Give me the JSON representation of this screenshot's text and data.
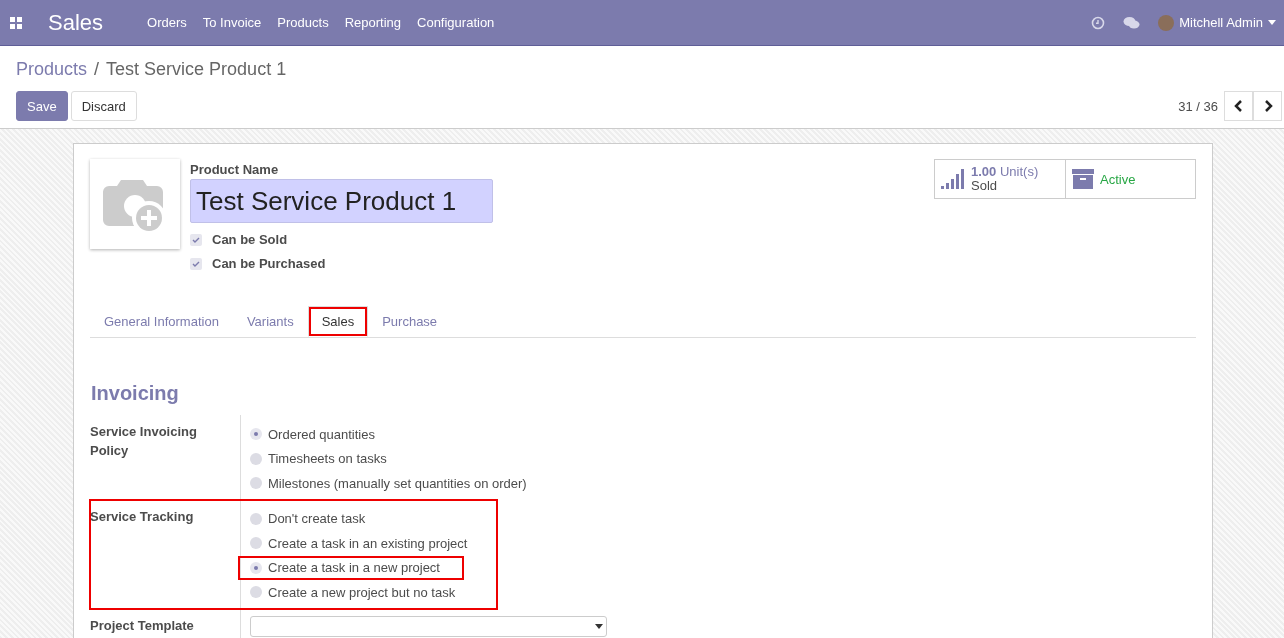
{
  "navbar": {
    "app_title": "Sales",
    "menu": [
      "Orders",
      "To Invoice",
      "Products",
      "Reporting",
      "Configuration"
    ],
    "user": "Mitchell Admin"
  },
  "breadcrumb": {
    "parent": "Products",
    "separator": "/",
    "current": "Test Service Product 1"
  },
  "buttons": {
    "save": "Save",
    "discard": "Discard"
  },
  "pager": "31 / 36",
  "product": {
    "name_label": "Product Name",
    "name": "Test Service Product 1",
    "checkboxes": [
      {
        "label": "Can be Sold",
        "checked": true
      },
      {
        "label": "Can be Purchased",
        "checked": true
      }
    ]
  },
  "stat_buttons": [
    {
      "kind": "sold",
      "value": "1.00",
      "unit": "Unit(s)",
      "label": "Sold"
    },
    {
      "kind": "archive",
      "label": "Active"
    }
  ],
  "tabs": [
    {
      "label": "General Information",
      "selected": false,
      "highlighted": false
    },
    {
      "label": "Variants",
      "selected": false,
      "highlighted": false
    },
    {
      "label": "Sales",
      "selected": true,
      "highlighted": true
    },
    {
      "label": "Purchase",
      "selected": false,
      "highlighted": false
    }
  ],
  "section_title": "Invoicing",
  "fields": [
    {
      "kind": "radio",
      "label": "Service Invoicing Policy",
      "highlighted": false,
      "options": [
        {
          "label": "Ordered quantities",
          "selected": true,
          "highlighted": false
        },
        {
          "label": "Timesheets on tasks",
          "selected": false,
          "highlighted": false
        },
        {
          "label": "Milestones (manually set quantities on order)",
          "selected": false,
          "highlighted": false
        }
      ]
    },
    {
      "kind": "radio",
      "label": "Service Tracking",
      "highlighted": true,
      "options": [
        {
          "label": "Don't create task",
          "selected": false,
          "highlighted": false
        },
        {
          "label": "Create a task in an existing project",
          "selected": false,
          "highlighted": false
        },
        {
          "label": "Create a task in a new project",
          "selected": true,
          "highlighted": true
        },
        {
          "label": "Create a new project but no task",
          "selected": false,
          "highlighted": false
        }
      ]
    },
    {
      "kind": "select",
      "label": "Project Template",
      "highlighted": false
    }
  ]
}
